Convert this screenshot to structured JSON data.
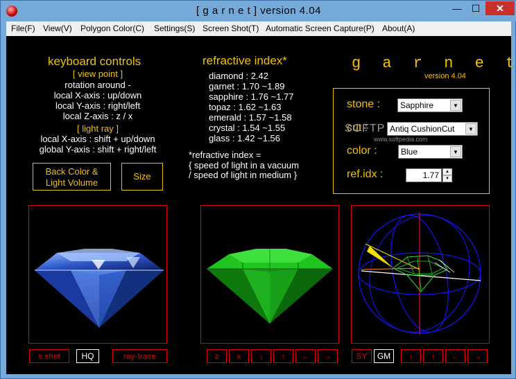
{
  "window": {
    "title": "[ g a r n e t ] version 4.04",
    "minimize_glyph": "—",
    "maximize_glyph": "☐",
    "close_glyph": "✕"
  },
  "menu": [
    "File(F)",
    "View(V)",
    "Polygon Color(C)",
    "Settings(S)",
    "Screen Shot(T)",
    "Automatic Screen Capture(P)",
    "About(A)"
  ],
  "keyboard_controls": {
    "title": "keyboard controls",
    "view_point_header": "[ view point ]",
    "lines": [
      "rotation around -",
      "local X-axis : up/down",
      "local Y-axis : right/left",
      "local Z-axis : z / x"
    ],
    "light_ray_header": "[ light ray ]",
    "light_lines": [
      "local X-axis : shift + up/down",
      "global Y-axis : shift + right/left"
    ]
  },
  "refractive_index": {
    "title": "refractive index*",
    "entries": [
      "diamond  : 2.42",
      "garnet   : 1.70 ~1.89",
      "sapphire : 1.76 ~1.77",
      "topaz    : 1.62 ~1.63",
      "emerald  : 1.57 ~1.58",
      "crystal  : 1.54 ~1.55",
      "glass    : 1.42 ~1.56"
    ],
    "note_lines": [
      "*refractive index =",
      "{ speed of light in a vacuum",
      " / speed of light in medium }"
    ]
  },
  "logo": {
    "name": "g a r n e t",
    "version": "version 4.04"
  },
  "settings": {
    "stone_label": "stone :",
    "stone_value": "Sapphire",
    "cut_label": "cut :",
    "cut_value": "Antiq CushionCut",
    "color_label": "color :",
    "color_value": "Blue",
    "refidx_label": "ref.idx :",
    "refidx_value": "1.77"
  },
  "buttons": {
    "back_color_line1": "Back Color &",
    "back_color_line2": "Light Volume",
    "size": "Size"
  },
  "viewport_left": {
    "sshot": "s.shot",
    "hq": "HQ",
    "raytrace": "ray-trace"
  },
  "viewport_mid": {
    "z": "z",
    "x": "x",
    "down": "↓",
    "up": "↑",
    "left": "←",
    "right": "→"
  },
  "viewport_right": {
    "sy": "SY",
    "gm": "GM",
    "down": "↓",
    "up": "↑",
    "left": "←",
    "right": "→"
  },
  "watermark": {
    "text": "SOFTP",
    "sub": "www.softpedia.com"
  },
  "colors": {
    "accent": "#f2c200",
    "frame": "#e00000",
    "gem_blue": "#3a6fd8",
    "gem_green": "#1fb81f",
    "wire_blue": "#1010ff"
  }
}
